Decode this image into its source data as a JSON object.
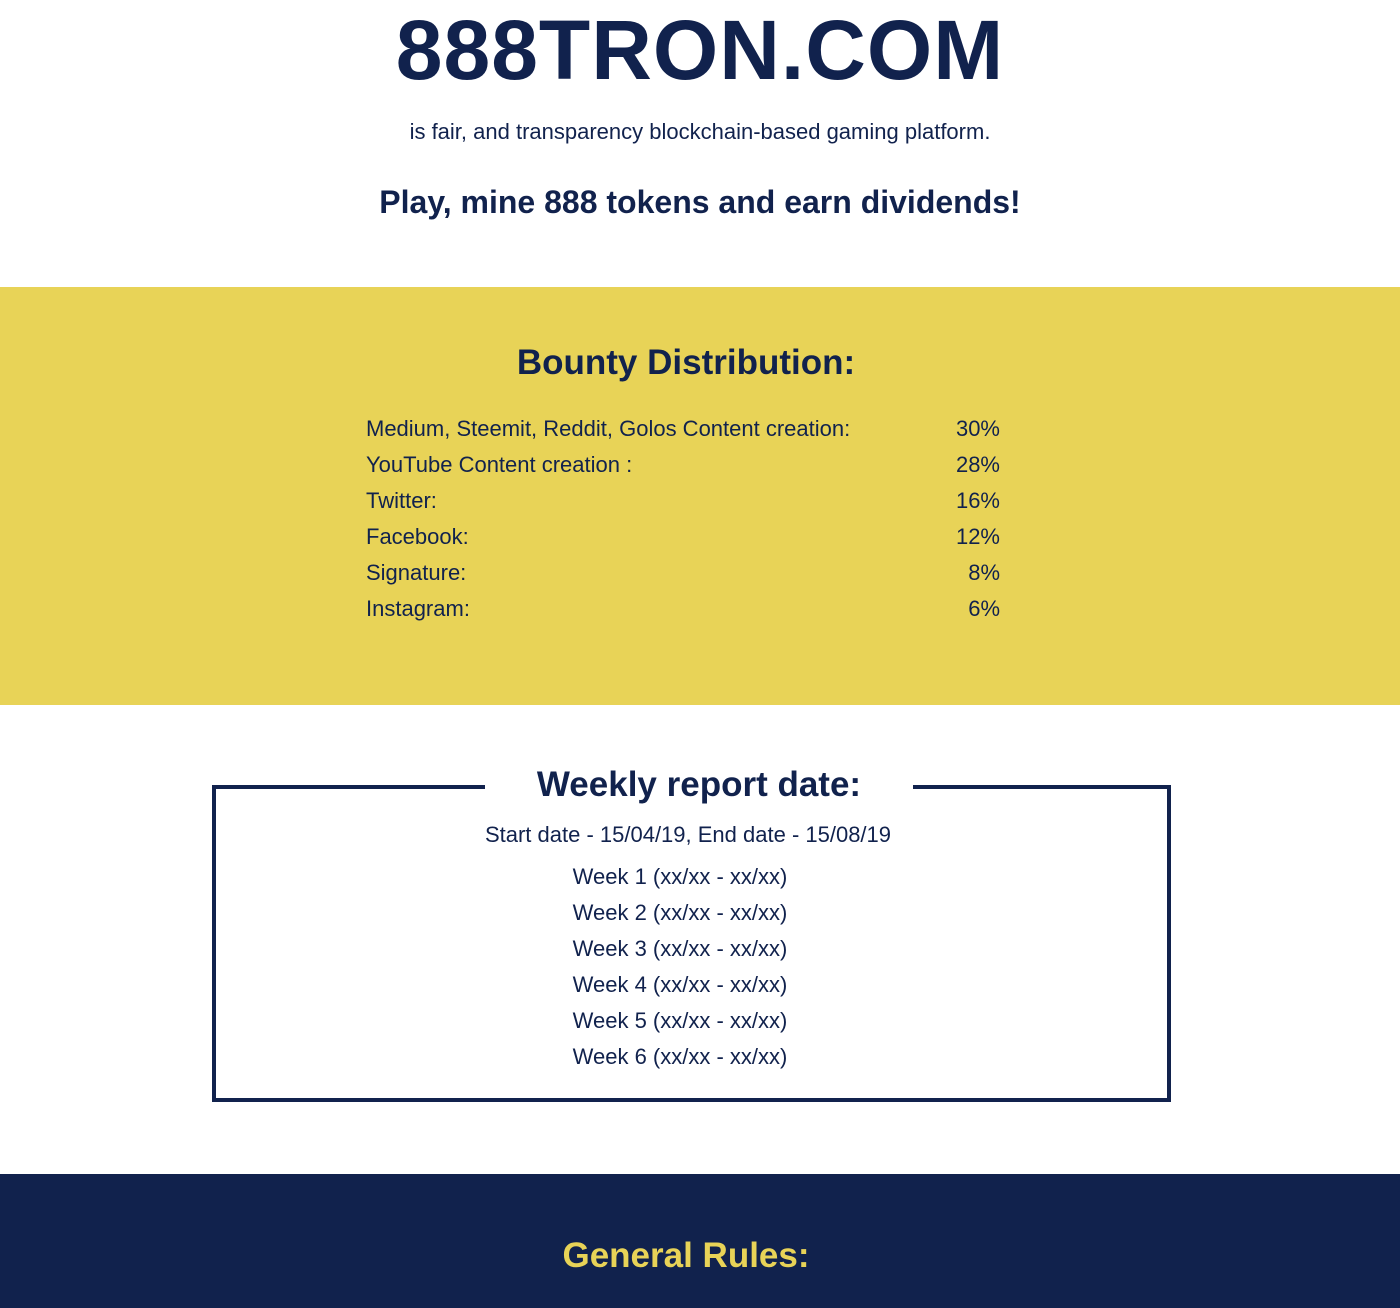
{
  "hero": {
    "brand": "888TRON.COM",
    "tagline": "is fair, and transparency blockchain-based gaming platform.",
    "cta": "Play, mine 888 tokens and earn dividends!"
  },
  "bounty": {
    "title": "Bounty Distribution:",
    "rows": [
      {
        "label": "Medium, Steemit, Reddit, Golos Content creation:",
        "value": "30%"
      },
      {
        "label": "YouTube Content creation :",
        "value": "28%"
      },
      {
        "label": "Twitter:",
        "value": "16%"
      },
      {
        "label": "Facebook:",
        "value": "12%"
      },
      {
        "label": "Signature:",
        "value": "8%"
      },
      {
        "label": "Instagram:",
        "value": "6%"
      }
    ]
  },
  "weekly": {
    "title": "Weekly report date:",
    "dates": "Start date - 15/04/19, End date - 15/08/19",
    "weeks": [
      "Week 1 (xx/xx - xx/xx)",
      "Week 2 (xx/xx - xx/xx)",
      "Week 3 (xx/xx - xx/xx)",
      "Week 4 (xx/xx - xx/xx)",
      "Week 5 (xx/xx - xx/xx)",
      "Week 6 (xx/xx - xx/xx)"
    ]
  },
  "rules": {
    "title": "General Rules:"
  },
  "colors": {
    "navy": "#11224d",
    "yellow": "#e8d357",
    "white": "#ffffff"
  }
}
